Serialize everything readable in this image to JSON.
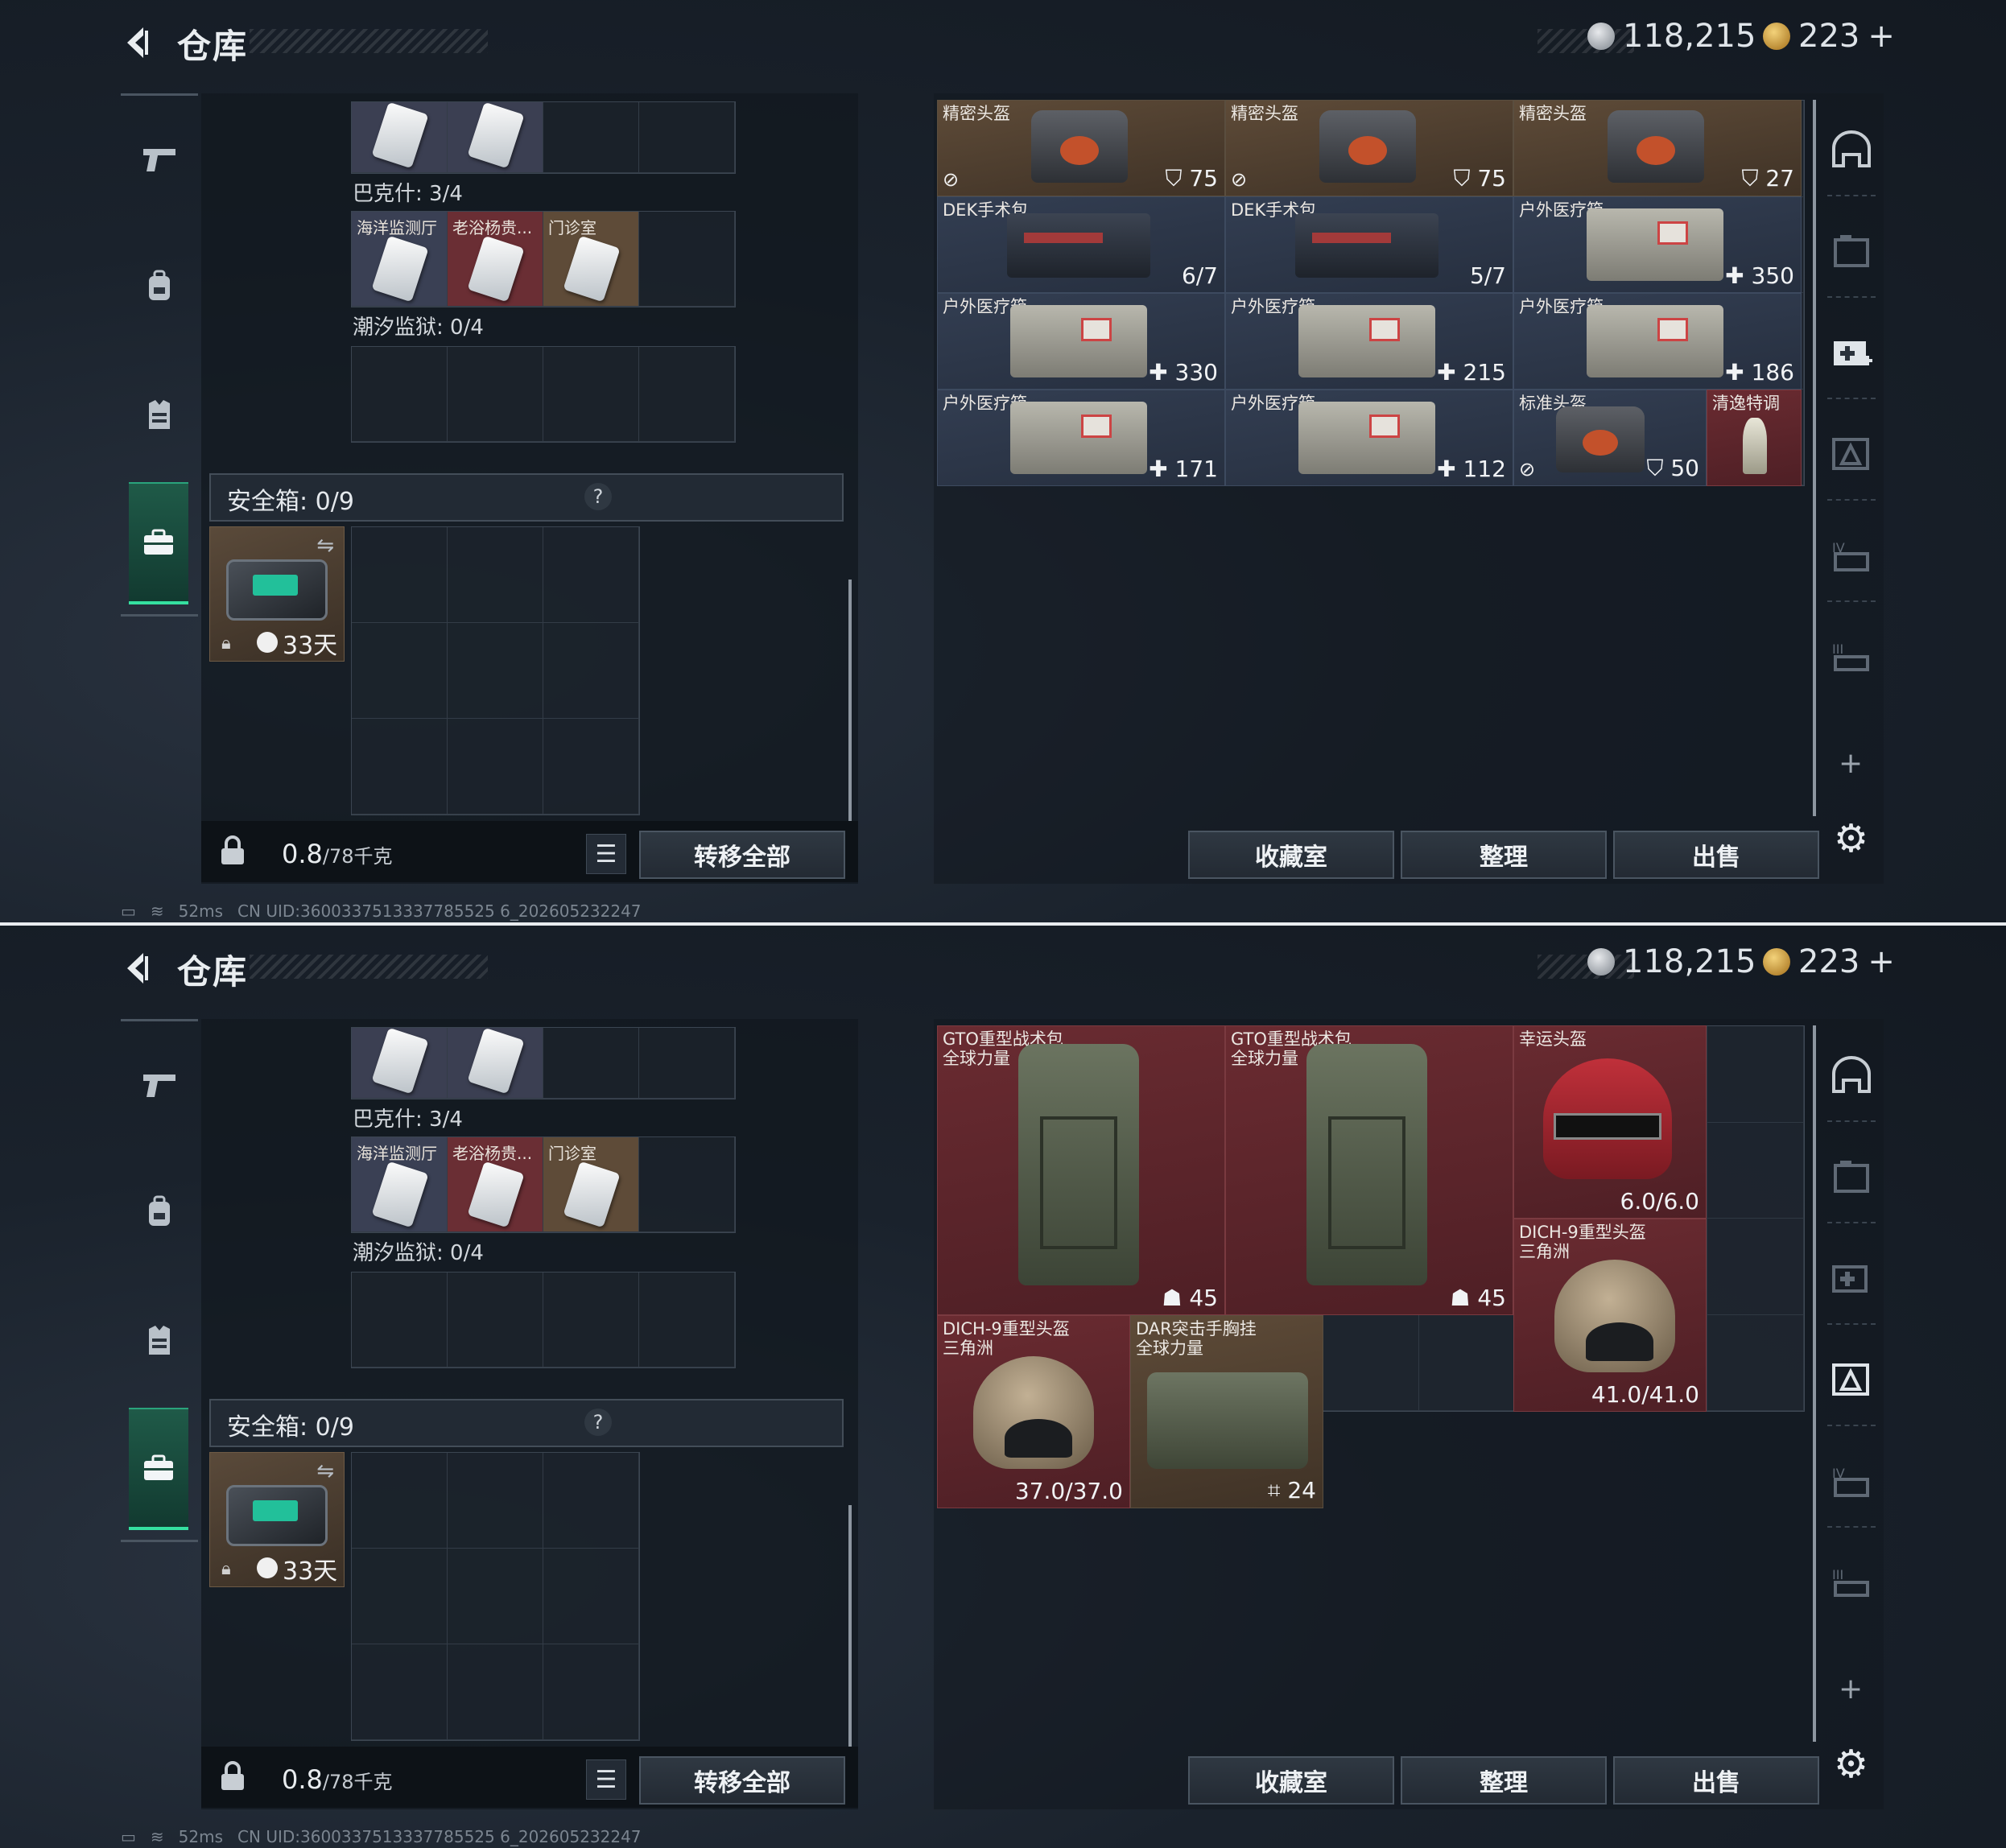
{
  "screens": [
    {
      "header": {
        "title": "仓库"
      },
      "currency": {
        "silver": "118,215",
        "gold": "223"
      },
      "left": {
        "top_cards": [
          "",
          ""
        ],
        "section1": "巴克什: 3/4",
        "cards1": [
          "海洋监测厅",
          "老浴杨贵...",
          "门诊室"
        ],
        "section2": "潮汐监狱: 0/4",
        "safe_label": "安全箱: 0/9",
        "safe_help": "?",
        "safe_days": "33天",
        "weight_value": "0.8",
        "weight_unit": "/78千克",
        "transfer_all": "转移全部"
      },
      "items": [
        {
          "name": "精密头盔",
          "val": "75"
        },
        {
          "name": "精密头盔",
          "val": "75"
        },
        {
          "name": "精密头盔",
          "val": "27"
        },
        {
          "name": "DEK手术包",
          "val": "6/7"
        },
        {
          "name": "DEK手术包",
          "val": "5/7"
        },
        {
          "name": "户外医疗箱",
          "val": "350"
        },
        {
          "name": "户外医疗箱",
          "val": "330"
        },
        {
          "name": "户外医疗箱",
          "val": "215"
        },
        {
          "name": "户外医疗箱",
          "val": "186"
        },
        {
          "name": "户外医疗箱",
          "val": "171"
        },
        {
          "name": "户外医疗箱",
          "val": "112"
        },
        {
          "name": "标准头盔",
          "val": "50"
        },
        {
          "name": "清逸特调",
          "val": ""
        }
      ],
      "buttons": {
        "collection": "收藏室",
        "sort": "整理",
        "sell": "出售"
      },
      "status": {
        "ping": "52ms",
        "uid": "CN UID:3600337513337785525 6_202605232247"
      }
    },
    {
      "header": {
        "title": "仓库"
      },
      "currency": {
        "silver": "118,215",
        "gold": "223"
      },
      "left": {
        "top_cards": [
          "",
          ""
        ],
        "section1": "巴克什: 3/4",
        "cards1": [
          "海洋监测厅",
          "老浴杨贵...",
          "门诊室"
        ],
        "section2": "潮汐监狱: 0/4",
        "safe_label": "安全箱: 0/9",
        "safe_help": "?",
        "safe_days": "33天",
        "weight_value": "0.8",
        "weight_unit": "/78千克",
        "transfer_all": "转移全部"
      },
      "items": [
        {
          "name": "GTO重型战术包",
          "sub": "全球力量",
          "val": "45"
        },
        {
          "name": "GTO重型战术包",
          "sub": "全球力量",
          "val": "45"
        },
        {
          "name": "幸运头盔",
          "sub": "",
          "val": "6.0/6.0"
        },
        {
          "name": "DICH-9重型头盔",
          "sub": "三角洲",
          "val": "41.0/41.0"
        },
        {
          "name": "DICH-9重型头盔",
          "sub": "三角洲",
          "val": "37.0/37.0"
        },
        {
          "name": "DAR突击手胸挂",
          "sub": "全球力量",
          "val": "24"
        }
      ],
      "buttons": {
        "collection": "收藏室",
        "sort": "整理",
        "sell": "出售"
      },
      "status": {
        "ping": "52ms",
        "uid": "CN UID:3600337513337785525 6_202605232247"
      }
    }
  ],
  "icons": [
    "back-arrow-icon",
    "pistol-icon",
    "backpack-icon",
    "vest-icon",
    "briefcase-icon",
    "helmet-slot-icon",
    "armor-slot-icon",
    "medkit-slot-icon",
    "triangle-slot-icon",
    "iv-slot-icon",
    "iii-slot-icon",
    "plus-icon",
    "gear-icon",
    "lock-icon",
    "list-icon",
    "swap-icon",
    "clock-icon",
    "silver-coin-icon",
    "gold-coin-icon"
  ],
  "colors": {
    "accent": "#35e0a0",
    "gold_rarity": "#5e4b38",
    "blue_rarity": "#333e52",
    "red_rarity": "#6a2b31"
  }
}
